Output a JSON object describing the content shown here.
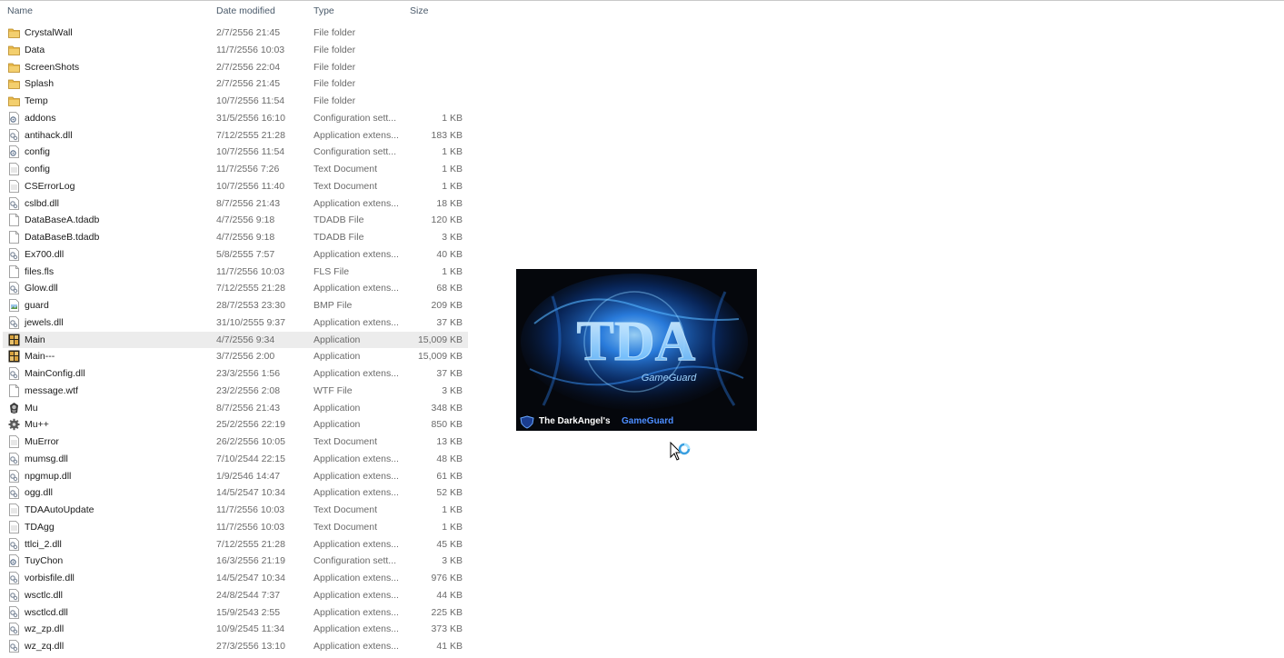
{
  "columns": {
    "name": "Name",
    "date": "Date modified",
    "type": "Type",
    "size": "Size"
  },
  "files": [
    {
      "name": "CrystalWall",
      "date": "2/7/2556 21:45",
      "type": "File folder",
      "size": "",
      "icon": "folder-icon"
    },
    {
      "name": "Data",
      "date": "11/7/2556 10:03",
      "type": "File folder",
      "size": "",
      "icon": "folder-icon"
    },
    {
      "name": "ScreenShots",
      "date": "2/7/2556 22:04",
      "type": "File folder",
      "size": "",
      "icon": "folder-icon"
    },
    {
      "name": "Splash",
      "date": "2/7/2556 21:45",
      "type": "File folder",
      "size": "",
      "icon": "folder-icon"
    },
    {
      "name": "Temp",
      "date": "10/7/2556 11:54",
      "type": "File folder",
      "size": "",
      "icon": "folder-icon"
    },
    {
      "name": "addons",
      "date": "31/5/2556 16:10",
      "type": "Configuration sett...",
      "size": "1 KB",
      "icon": "config-file-icon"
    },
    {
      "name": "antihack.dll",
      "date": "7/12/2555 21:28",
      "type": "Application extens...",
      "size": "183 KB",
      "icon": "dll-file-icon"
    },
    {
      "name": "config",
      "date": "10/7/2556 11:54",
      "type": "Configuration sett...",
      "size": "1 KB",
      "icon": "config-file-icon"
    },
    {
      "name": "config",
      "date": "11/7/2556 7:26",
      "type": "Text Document",
      "size": "1 KB",
      "icon": "text-file-icon"
    },
    {
      "name": "CSErrorLog",
      "date": "10/7/2556 11:40",
      "type": "Text Document",
      "size": "1 KB",
      "icon": "text-file-icon"
    },
    {
      "name": "cslbd.dll",
      "date": "8/7/2556 21:43",
      "type": "Application extens...",
      "size": "18 KB",
      "icon": "dll-file-icon"
    },
    {
      "name": "DataBaseA.tdadb",
      "date": "4/7/2556 9:18",
      "type": "TDADB File",
      "size": "120 KB",
      "icon": "blank-file-icon"
    },
    {
      "name": "DataBaseB.tdadb",
      "date": "4/7/2556 9:18",
      "type": "TDADB File",
      "size": "3 KB",
      "icon": "blank-file-icon"
    },
    {
      "name": "Ex700.dll",
      "date": "5/8/2555 7:57",
      "type": "Application extens...",
      "size": "40 KB",
      "icon": "dll-file-icon"
    },
    {
      "name": "files.fls",
      "date": "11/7/2556 10:03",
      "type": "FLS File",
      "size": "1 KB",
      "icon": "blank-file-icon"
    },
    {
      "name": "Glow.dll",
      "date": "7/12/2555 21:28",
      "type": "Application extens...",
      "size": "68 KB",
      "icon": "dll-file-icon"
    },
    {
      "name": "guard",
      "date": "28/7/2553 23:30",
      "type": "BMP File",
      "size": "209 KB",
      "icon": "image-file-icon"
    },
    {
      "name": "jewels.dll",
      "date": "31/10/2555 9:37",
      "type": "Application extens...",
      "size": "37 KB",
      "icon": "dll-file-icon"
    },
    {
      "name": "Main",
      "date": "4/7/2556 9:34",
      "type": "Application",
      "size": "15,009 KB",
      "icon": "mu-app-icon"
    },
    {
      "name": "Main---",
      "date": "3/7/2556 2:00",
      "type": "Application",
      "size": "15,009 KB",
      "icon": "mu-app-icon"
    },
    {
      "name": "MainConfig.dll",
      "date": "23/3/2556 1:56",
      "type": "Application extens...",
      "size": "37 KB",
      "icon": "dll-file-icon"
    },
    {
      "name": "message.wtf",
      "date": "23/2/2556 2:08",
      "type": "WTF File",
      "size": "3 KB",
      "icon": "blank-file-icon"
    },
    {
      "name": "Mu",
      "date": "8/7/2556 21:43",
      "type": "Application",
      "size": "348 KB",
      "icon": "mu-launcher-icon"
    },
    {
      "name": "Mu++",
      "date": "25/2/2556 22:19",
      "type": "Application",
      "size": "850 KB",
      "icon": "gear-app-icon"
    },
    {
      "name": "MuError",
      "date": "26/2/2556 10:05",
      "type": "Text Document",
      "size": "13 KB",
      "icon": "text-file-icon"
    },
    {
      "name": "mumsg.dll",
      "date": "7/10/2544 22:15",
      "type": "Application extens...",
      "size": "48 KB",
      "icon": "dll-file-icon"
    },
    {
      "name": "npgmup.dll",
      "date": "1/9/2546 14:47",
      "type": "Application extens...",
      "size": "61 KB",
      "icon": "dll-file-icon"
    },
    {
      "name": "ogg.dll",
      "date": "14/5/2547 10:34",
      "type": "Application extens...",
      "size": "52 KB",
      "icon": "dll-file-icon"
    },
    {
      "name": "TDAAutoUpdate",
      "date": "11/7/2556 10:03",
      "type": "Text Document",
      "size": "1 KB",
      "icon": "text-file-icon"
    },
    {
      "name": "TDAgg",
      "date": "11/7/2556 10:03",
      "type": "Text Document",
      "size": "1 KB",
      "icon": "text-file-icon"
    },
    {
      "name": "ttlci_2.dll",
      "date": "7/12/2555 21:28",
      "type": "Application extens...",
      "size": "45 KB",
      "icon": "dll-file-icon"
    },
    {
      "name": "TuyChon",
      "date": "16/3/2556 21:19",
      "type": "Configuration sett...",
      "size": "3 KB",
      "icon": "config-file-icon"
    },
    {
      "name": "vorbisfile.dll",
      "date": "14/5/2547 10:34",
      "type": "Application extens...",
      "size": "976 KB",
      "icon": "dll-file-icon"
    },
    {
      "name": "wsctlc.dll",
      "date": "24/8/2544 7:37",
      "type": "Application extens...",
      "size": "44 KB",
      "icon": "dll-file-icon"
    },
    {
      "name": "wsctlcd.dll",
      "date": "15/9/2543 2:55",
      "type": "Application extens...",
      "size": "225 KB",
      "icon": "dll-file-icon"
    },
    {
      "name": "wz_zp.dll",
      "date": "10/9/2545 11:34",
      "type": "Application extens...",
      "size": "373 KB",
      "icon": "dll-file-icon"
    },
    {
      "name": "wz_zq.dll",
      "date": "27/3/2556 13:10",
      "type": "Application extens...",
      "size": "41 KB",
      "icon": "dll-file-icon"
    }
  ],
  "selected_file": "Main",
  "splash": {
    "logo_text": "TDA",
    "logo_subtext": "GameGuard",
    "caption_white": "The DarkAngel's",
    "caption_blue": "GameGuard",
    "caption_blue_color": "#4c8dff"
  },
  "cursor": {
    "state": "busy",
    "icon": "busy-cursor-icon"
  },
  "colors": {
    "folder": "#e8b84a",
    "selected_row": "#ececec",
    "splash_bg": "#05070c",
    "glow": "#3aa2ff"
  }
}
